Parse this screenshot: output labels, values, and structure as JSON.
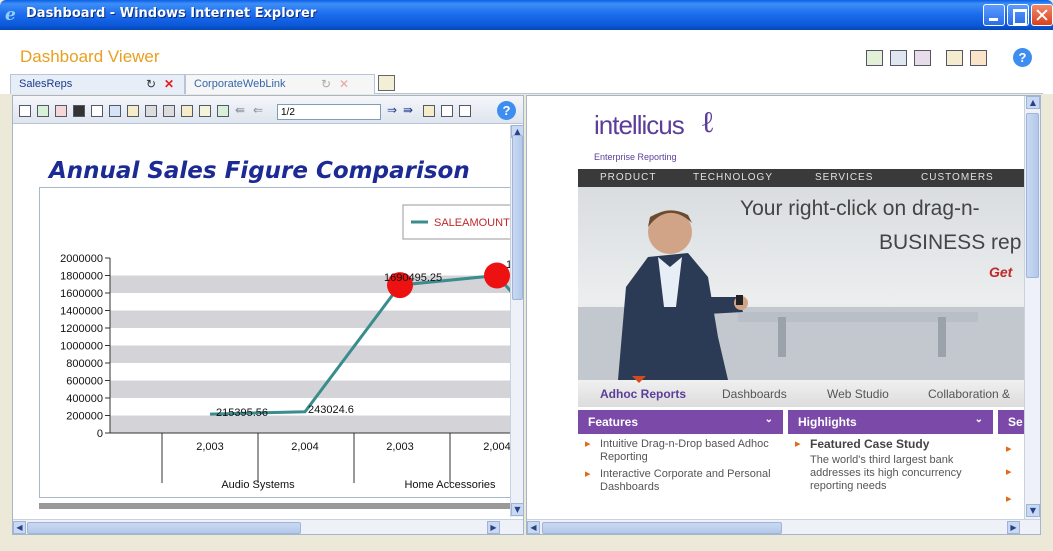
{
  "window": {
    "title": "Dashboard - Windows Internet Explorer"
  },
  "dashboard": {
    "title": "Dashboard Viewer"
  },
  "tabs": [
    {
      "label": "SalesReps"
    },
    {
      "label": "CorporateWebLink"
    }
  ],
  "report_toolbar": {
    "page_value": "1/2"
  },
  "chart_data": {
    "type": "line",
    "title": "Annual Sales Figure Comparison",
    "legend": [
      "SALEAMOUNT"
    ],
    "legend_position": "top-right",
    "ylim": [
      0,
      2000000
    ],
    "y_ticks": [
      "2000000",
      "1800000",
      "1600000",
      "1400000",
      "1200000",
      "1000000",
      "800000",
      "600000",
      "400000",
      "200000",
      "0"
    ],
    "x_ticks": [
      "2,003",
      "2,004",
      "2,003",
      "2,004"
    ],
    "groups": [
      "Audio Systems",
      "Home Accessories"
    ],
    "series": [
      {
        "name": "SALEAMOUNT",
        "values": [
          215395.56,
          243024.6,
          1690495.25,
          1800000
        ]
      }
    ],
    "data_labels": [
      "215395.56",
      "243024.6",
      "1690495.25",
      "18"
    ],
    "grid": true,
    "color": "#3b8c8c"
  },
  "web": {
    "brand": "intellicus",
    "brand_sub": "Enterprise Reporting",
    "nav": [
      "PRODUCT",
      "TECHNOLOGY",
      "SERVICES",
      "CUSTOMERS"
    ],
    "hero_line1": "Your right-click on drag-n-",
    "hero_line2": "BUSINESS rep",
    "hero_line3": "Get",
    "subtabs": [
      "Adhoc Reports",
      "Dashboards",
      "Web Studio",
      "Collaboration &"
    ],
    "features": {
      "title": "Features",
      "items": [
        "Intuitive Drag-n-Drop based Adhoc Reporting",
        "Interactive Corporate and Personal Dashboards"
      ]
    },
    "highlights": {
      "title": "Highlights",
      "item_title": "Featured Case Study",
      "item_text": "The world's third largest bank addresses its high concurrency reporting needs"
    },
    "third_col": {
      "title": "Se"
    }
  }
}
